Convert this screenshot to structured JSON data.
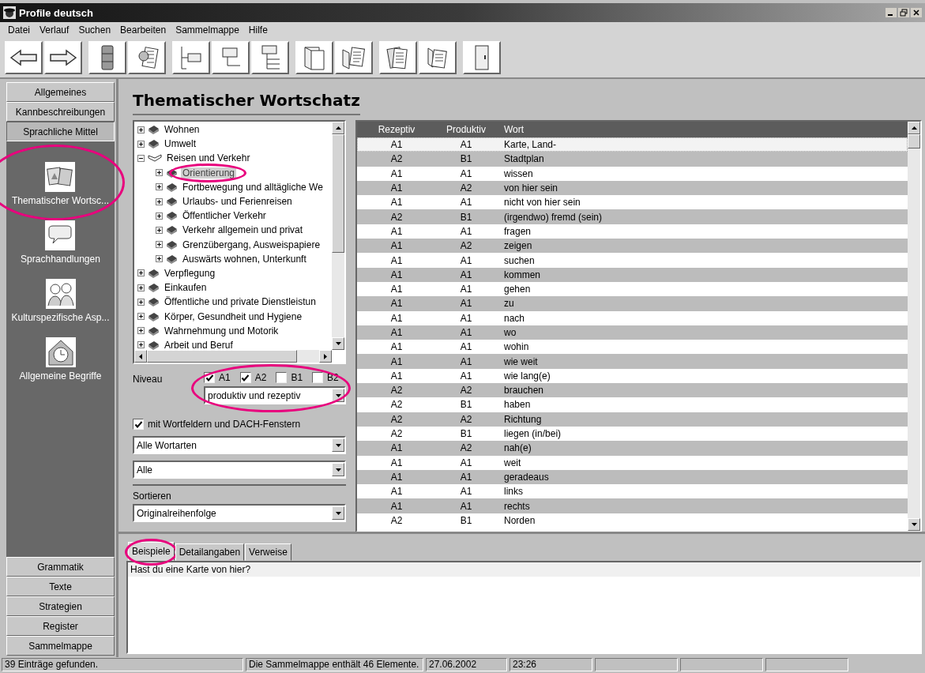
{
  "window": {
    "title": "Profile deutsch"
  },
  "menu": [
    "Datei",
    "Verlauf",
    "Suchen",
    "Bearbeiten",
    "Sammelmappe",
    "Hilfe"
  ],
  "sidebar": {
    "sections": [
      {
        "label": "Allgemeines",
        "selected": false
      },
      {
        "label": "Kannbeschreibungen",
        "selected": false
      },
      {
        "label": "Sprachliche Mittel",
        "selected": true
      }
    ],
    "items": [
      {
        "label": "Thematischer Wortsc...",
        "kind": "pictures",
        "circled": true
      },
      {
        "label": "Sprachhandlungen",
        "kind": "speech",
        "circled": false
      },
      {
        "label": "Kulturspezifische Asp...",
        "kind": "people",
        "circled": false
      },
      {
        "label": "Allgemeine Begriffe",
        "kind": "clock",
        "circled": false
      }
    ],
    "bottom_sections": [
      {
        "label": "Grammatik",
        "selected": false
      },
      {
        "label": "Texte",
        "selected": false
      },
      {
        "label": "Strategien",
        "selected": false
      },
      {
        "label": "Register",
        "selected": false
      },
      {
        "label": "Sammelmappe",
        "selected": false
      }
    ]
  },
  "heading": "Thematischer Wortschatz",
  "tree": {
    "nodes": [
      {
        "label": "Wohnen",
        "expanded": false,
        "selected": false,
        "circled": false
      },
      {
        "label": "Umwelt",
        "expanded": false,
        "selected": false,
        "circled": false
      },
      {
        "label": "Reisen und Verkehr",
        "expanded": true,
        "selected": false,
        "circled": false,
        "children": [
          {
            "label": "Orientierung",
            "expanded": false,
            "selected": true,
            "circled": true
          },
          {
            "label": "Fortbewegung und alltägliche We",
            "expanded": false,
            "selected": false,
            "circled": false
          },
          {
            "label": "Urlaubs- und Ferienreisen",
            "expanded": false,
            "selected": false,
            "circled": false
          },
          {
            "label": "Öffentlicher Verkehr",
            "expanded": false,
            "selected": false,
            "circled": false
          },
          {
            "label": "Verkehr allgemein und privat",
            "expanded": false,
            "selected": false,
            "circled": false
          },
          {
            "label": "Grenzübergang, Ausweispapiere",
            "expanded": false,
            "selected": false,
            "circled": false
          },
          {
            "label": "Auswärts wohnen, Unterkunft",
            "expanded": false,
            "selected": false,
            "circled": false
          }
        ]
      },
      {
        "label": "Verpflegung",
        "expanded": false,
        "selected": false,
        "circled": false
      },
      {
        "label": "Einkaufen",
        "expanded": false,
        "selected": false,
        "circled": false
      },
      {
        "label": "Öffentliche und private Dienstleistun",
        "expanded": false,
        "selected": false,
        "circled": false
      },
      {
        "label": "Körper, Gesundheit und Hygiene",
        "expanded": false,
        "selected": false,
        "circled": false
      },
      {
        "label": "Wahrnehmung und Motorik",
        "expanded": false,
        "selected": false,
        "circled": false
      },
      {
        "label": "Arbeit und Beruf",
        "expanded": false,
        "selected": false,
        "circled": false
      }
    ]
  },
  "niveau": {
    "label": "Niveau",
    "circled": true,
    "levels": [
      {
        "label": "A1",
        "checked": true
      },
      {
        "label": "A2",
        "checked": true
      },
      {
        "label": "B1",
        "checked": false
      },
      {
        "label": "B2",
        "checked": false
      }
    ],
    "mode": "produktiv und rezeptiv"
  },
  "word_fields": {
    "label": "mit Wortfeldern und DACH-Fenstern",
    "checked": true
  },
  "word_class": "Alle Wortarten",
  "filter": "Alle",
  "sort": {
    "label": "Sortieren",
    "value": "Originalreihenfolge"
  },
  "table": {
    "columns": [
      "Rezeptiv",
      "Produktiv",
      "Wort"
    ],
    "rows": [
      {
        "rezeptiv": "A1",
        "produktiv": "A1",
        "wort": "Karte, Land-",
        "selected": true
      },
      {
        "rezeptiv": "A2",
        "produktiv": "B1",
        "wort": "Stadtplan",
        "selected": false
      },
      {
        "rezeptiv": "A1",
        "produktiv": "A1",
        "wort": "wissen",
        "selected": false
      },
      {
        "rezeptiv": "A1",
        "produktiv": "A2",
        "wort": "von hier sein",
        "selected": false
      },
      {
        "rezeptiv": "A1",
        "produktiv": "A1",
        "wort": "nicht von hier sein",
        "selected": false
      },
      {
        "rezeptiv": "A2",
        "produktiv": "B1",
        "wort": "(irgendwo) fremd (sein)",
        "selected": false
      },
      {
        "rezeptiv": "A1",
        "produktiv": "A1",
        "wort": "fragen",
        "selected": false
      },
      {
        "rezeptiv": "A1",
        "produktiv": "A2",
        "wort": "zeigen",
        "selected": false
      },
      {
        "rezeptiv": "A1",
        "produktiv": "A1",
        "wort": "suchen",
        "selected": false
      },
      {
        "rezeptiv": "A1",
        "produktiv": "A1",
        "wort": "kommen",
        "selected": false
      },
      {
        "rezeptiv": "A1",
        "produktiv": "A1",
        "wort": "gehen",
        "selected": false
      },
      {
        "rezeptiv": "A1",
        "produktiv": "A1",
        "wort": "zu",
        "selected": false
      },
      {
        "rezeptiv": "A1",
        "produktiv": "A1",
        "wort": "nach",
        "selected": false
      },
      {
        "rezeptiv": "A1",
        "produktiv": "A1",
        "wort": "wo",
        "selected": false
      },
      {
        "rezeptiv": "A1",
        "produktiv": "A1",
        "wort": "wohin",
        "selected": false
      },
      {
        "rezeptiv": "A1",
        "produktiv": "A1",
        "wort": "wie weit",
        "selected": false
      },
      {
        "rezeptiv": "A1",
        "produktiv": "A1",
        "wort": "wie lang(e)",
        "selected": false
      },
      {
        "rezeptiv": "A2",
        "produktiv": "A2",
        "wort": "brauchen",
        "selected": false
      },
      {
        "rezeptiv": "A2",
        "produktiv": "B1",
        "wort": "haben",
        "selected": false
      },
      {
        "rezeptiv": "A2",
        "produktiv": "A2",
        "wort": "Richtung",
        "selected": false
      },
      {
        "rezeptiv": "A2",
        "produktiv": "B1",
        "wort": "liegen (in/bei)",
        "selected": false
      },
      {
        "rezeptiv": "A1",
        "produktiv": "A2",
        "wort": "nah(e)",
        "selected": false
      },
      {
        "rezeptiv": "A1",
        "produktiv": "A1",
        "wort": "weit",
        "selected": false
      },
      {
        "rezeptiv": "A1",
        "produktiv": "A1",
        "wort": "geradeaus",
        "selected": false
      },
      {
        "rezeptiv": "A1",
        "produktiv": "A1",
        "wort": "links",
        "selected": false
      },
      {
        "rezeptiv": "A1",
        "produktiv": "A1",
        "wort": "rechts",
        "selected": false
      },
      {
        "rezeptiv": "A2",
        "produktiv": "B1",
        "wort": "Norden",
        "selected": false
      }
    ]
  },
  "details": {
    "tabs": [
      {
        "label": "Beispiele",
        "selected": true,
        "circled": true
      },
      {
        "label": "Detailangaben",
        "selected": false,
        "circled": false
      },
      {
        "label": "Verweise",
        "selected": false,
        "circled": false
      }
    ],
    "examples": [
      "Hast du eine Karte von hier?"
    ]
  },
  "status_bar": [
    "39 Einträge gefunden.",
    "Die Sammelmappe enthält 46 Elemente.",
    "27.06.2002",
    "23:26"
  ]
}
